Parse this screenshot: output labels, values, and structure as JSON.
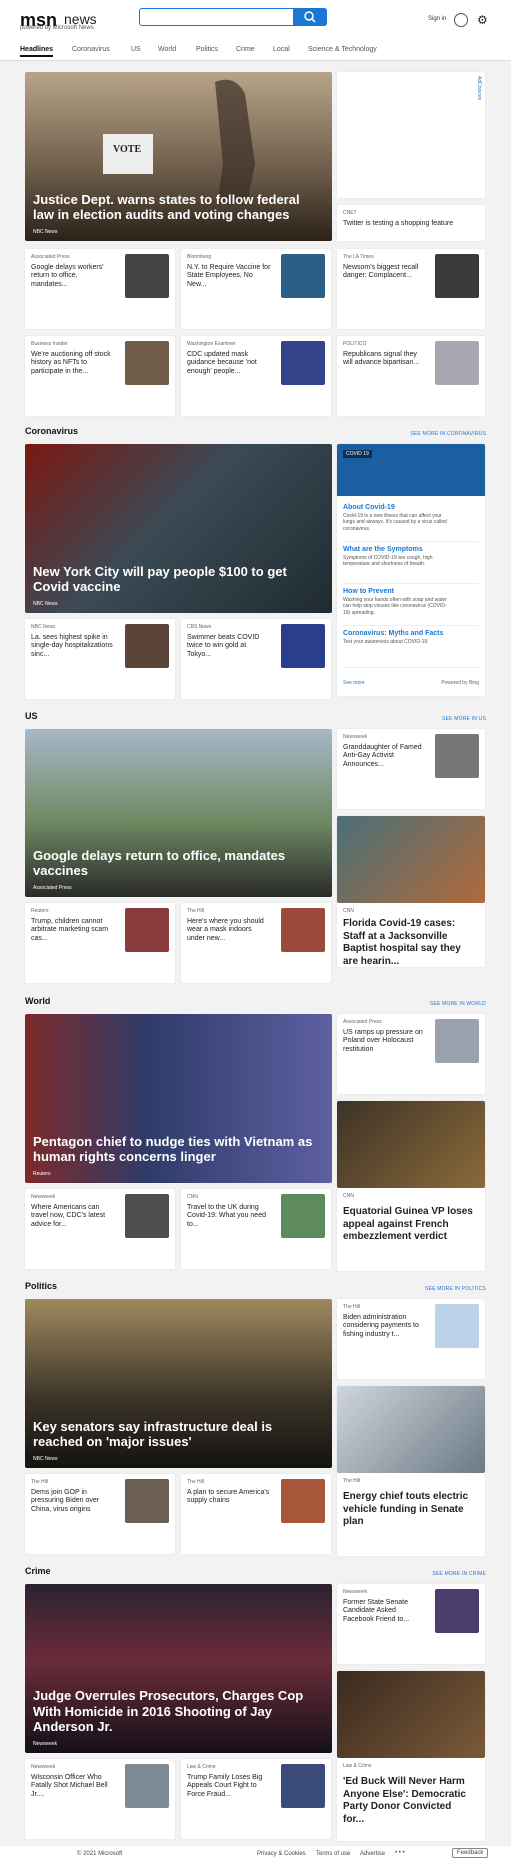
{
  "header": {
    "logo": "msn",
    "news": "news",
    "powered": "powered by Microsoft News",
    "search_placeholder": "",
    "signin": "Sign in"
  },
  "tabs": [
    "Headlines",
    "Coronavirus",
    "US",
    "World",
    "Politics",
    "Crime",
    "Local",
    "Science & Technology"
  ],
  "headlines": {
    "hero": {
      "title": "Justice Dept. warns states to follow federal law in election audits and voting changes",
      "source": "NBC News"
    },
    "adchoices": "AdChoices",
    "side": {
      "source": "CNET",
      "title": "Twitter is testing a shopping feature"
    },
    "cards": [
      {
        "source": "Associated Press",
        "title": "Google delays workers' return to office, mandates..."
      },
      {
        "source": "Bloomberg",
        "title": "N.Y. to Require Vaccine for State Employees, No New..."
      },
      {
        "source": "The LA Times",
        "title": "Newsom's biggest recall danger: Complacent..."
      },
      {
        "source": "Business Insider",
        "title": "We're auctioning off stock history as NFTs to participate in the..."
      },
      {
        "source": "Washington Examiner",
        "title": "CDC updated mask guidance because 'not enough' people..."
      },
      {
        "source": "POLITICO",
        "title": "Republicans signal they will advance bipartisan..."
      }
    ]
  },
  "coronavirus": {
    "section": "Coronavirus",
    "more": "SEE MORE IN CORONAVIRUS",
    "hero": {
      "title": "New York City will pay people $100 to get Covid vaccine",
      "source": "NBC News"
    },
    "panel": {
      "tag": "COVID 19",
      "rows": [
        {
          "title": "About Covid-19",
          "text": "Covid-19 is a new illness that can affect your lungs and airways. It's caused by a virus called coronavirus."
        },
        {
          "title": "What are the Symptoms",
          "text": "Symptoms of COVID-19 are cough, high temperature and shortness of breath."
        },
        {
          "title": "How to Prevent",
          "text": "Washing your hands often with soap and water can help stop viruses like coronavirus (COVID-19) spreading."
        },
        {
          "title": "Coronavirus: Myths and Facts",
          "text": "Test your awareness about COVID-19."
        }
      ],
      "see_more": "See more",
      "powered": "Powered by Bing"
    },
    "cards": [
      {
        "source": "NBC News",
        "title": "La. sees highest spike in single-day hospitalizations sinc..."
      },
      {
        "source": "CBS News",
        "title": "Swimmer beats COVID twice to win gold at Tokyo..."
      }
    ]
  },
  "us": {
    "section": "US",
    "more": "SEE MORE IN US",
    "hero": {
      "title": "Google delays return to office, mandates vaccines",
      "source": "Associated Press"
    },
    "side": {
      "source": "Newsweek",
      "title": "Granddaughter of Famed Anti-Gay Activist Announces..."
    },
    "big": {
      "source": "CNN",
      "title": "Florida Covid-19 cases: Staff at a Jacksonville Baptist hospital say they are hearin..."
    },
    "cards": [
      {
        "source": "Reuters",
        "title": "Trump, children cannot arbitrate marketing scam cas..."
      },
      {
        "source": "The Hill",
        "title": "Here's where you should wear a mask indoors under new..."
      }
    ]
  },
  "world": {
    "section": "World",
    "more": "SEE MORE IN WORLD",
    "hero": {
      "title": "Pentagon chief to nudge ties with Vietnam as human rights concerns linger",
      "source": "Reuters"
    },
    "side": {
      "source": "Associated Press",
      "title": "US ramps up pressure on Poland over Holocaust restitution"
    },
    "big": {
      "source": "CNN",
      "title": "Equatorial Guinea VP loses appeal against French embezzlement verdict"
    },
    "cards": [
      {
        "source": "Newsweek",
        "title": "Where Americans can travel now, CDC's latest advice for..."
      },
      {
        "source": "CNN",
        "title": "Travel to the UK during Covid-19: What you need to..."
      }
    ]
  },
  "politics": {
    "section": "Politics",
    "more": "SEE MORE IN POLITICS",
    "hero": {
      "title": "Key senators say infrastructure deal is reached on 'major issues'",
      "source": "NBC News"
    },
    "side": {
      "source": "The Hill",
      "title": "Biden administration considering payments to fishing industry t..."
    },
    "big": {
      "source": "The Hill",
      "title": "Energy chief touts electric vehicle funding in Senate plan"
    },
    "cards": [
      {
        "source": "The Hill",
        "title": "Dems join GOP in pressuring Biden over China, virus origins"
      },
      {
        "source": "The Hill",
        "title": "A plan to secure America's supply chains"
      }
    ]
  },
  "crime": {
    "section": "Crime",
    "more": "SEE MORE IN CRIME",
    "hero": {
      "title": "Judge Overrules Prosecutors, Charges Cop With Homicide in 2016 Shooting of Jay Anderson Jr.",
      "source": "Newsweek"
    },
    "side": {
      "source": "Newsweek",
      "title": "Former State Senate Candidate Asked Facebook Friend to..."
    },
    "big": {
      "source": "Law & Crime",
      "title": "'Ed Buck Will Never Harm Anyone Else': Democratic Party Donor Convicted for..."
    },
    "cards": [
      {
        "source": "Newsweek",
        "title": "Wisconsin Officer Who Fatally Shot Michael Bell Jr...."
      },
      {
        "source": "Law & Crime",
        "title": "Trump Family Loses Big Appeals Court Fight to Force Fraud..."
      }
    ]
  },
  "footer": {
    "copyright": "© 2021 Microsoft",
    "privacy": "Privacy & Cookies",
    "terms": "Terms of use",
    "advertise": "Advertise",
    "feedback": "Feedback"
  }
}
